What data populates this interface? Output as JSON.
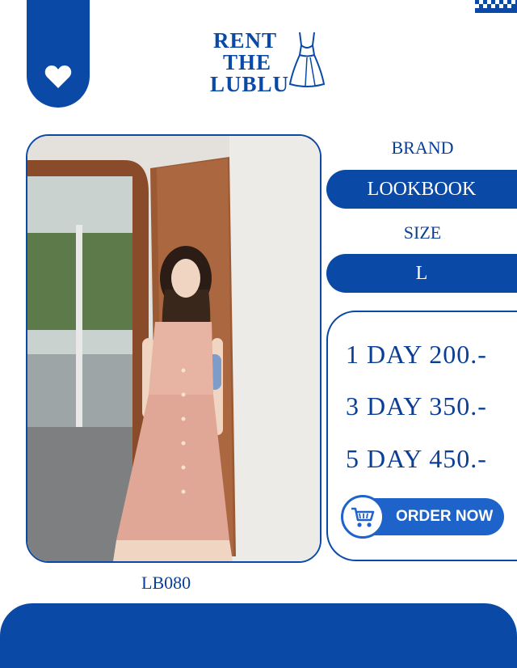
{
  "brand_logo": {
    "line1": "RENT",
    "line2": "THE",
    "line3": "LUBLU"
  },
  "product": {
    "code": "LB080"
  },
  "details": {
    "brand_label": "BRAND",
    "brand_value": "LOOKBOOK",
    "size_label": "SIZE",
    "size_value": "L"
  },
  "pricing": [
    {
      "text": "1 DAY 200.-"
    },
    {
      "text": "3 DAY 350.-"
    },
    {
      "text": "5 DAY 450.-"
    }
  ],
  "order_button": {
    "label": "ORDER NOW"
  },
  "colors": {
    "primary": "#0a4aa6",
    "button": "#1d63c9",
    "background": "#ffffff"
  },
  "icons": {
    "tab": "heart-icon",
    "logo": "dress-icon",
    "order": "cart-icon"
  }
}
